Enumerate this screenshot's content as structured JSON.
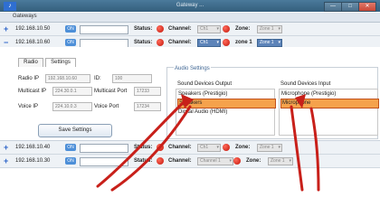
{
  "window": {
    "title": "Gateway ...",
    "minimize": "—",
    "maximize": "□",
    "close": "✕"
  },
  "gateways_label": "Gateways",
  "gateway_rows_top": [
    {
      "ip": "192.168.10.50",
      "on": "ON",
      "status": "Status:",
      "channel_label": "Channel:",
      "channel_value": "Ch1",
      "zone_label": "Zone:",
      "zone_value": "Zone 1",
      "expanded": false
    },
    {
      "ip": "192.168.10.60",
      "on": "ON",
      "status": "Status:",
      "channel_label": "Channel:",
      "channel_value": "Ch1",
      "zone_label": "zone 1",
      "zone_value": "Zone 1",
      "expanded": true
    }
  ],
  "tabs": [
    "Radio",
    "Settings"
  ],
  "settings": {
    "radio_ip_label": "Radio IP",
    "radio_ip_value": "192.168.10.60",
    "id_label": "ID:",
    "id_value": "100",
    "multicast_ip_label": "Multicast IP",
    "multicast_ip_value": "224.30.0.1",
    "multicast_port_label": "Multicast Port",
    "multicast_port_value": "17233",
    "voice_ip_label": "Voice IP",
    "voice_ip_value": "224.10.0.3",
    "voice_port_label": "Voice Port",
    "voice_port_value": "17234",
    "save_label": "Save Settings"
  },
  "audio": {
    "title": "Audio Settings",
    "output_title": "Sound Devices Output",
    "input_title": "Sound Devices Input",
    "outputs": [
      "Speakers (Prestigio)",
      "Speakers",
      "Digital Audio (HDMI)"
    ],
    "inputs": [
      "Microphone (Prestigio)",
      "Microphone"
    ],
    "selected_output": "Speakers",
    "selected_input": "Microphone",
    "highlight_color": "#f5a24c",
    "arrow_color": "#c8201a"
  },
  "gateway_rows_bottom": [
    {
      "ip": "192.168.10.40",
      "on": "ON",
      "status": "Status:",
      "channel_label": "Channel:",
      "channel_value": "Ch1",
      "zone_label": "Zone:",
      "zone_value": "Zone 1"
    },
    {
      "ip": "192.168.10.30",
      "on": "ON",
      "status": "Status:",
      "channel_label": "Channel:",
      "channel_value": "Channel 1",
      "zone_label": "Zone:",
      "zone_value": "Zone 1"
    }
  ]
}
